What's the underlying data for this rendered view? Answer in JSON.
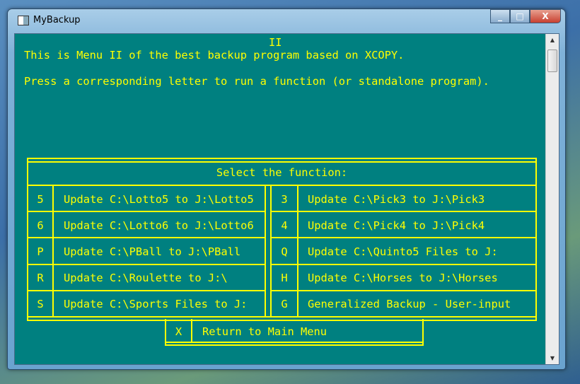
{
  "window": {
    "title": "MyBackup",
    "minimize": "_",
    "maximize": "□",
    "close": "X"
  },
  "console": {
    "heading": "II",
    "line1": "This is Menu II of the best backup program based on XCOPY.",
    "line2": "Press a corresponding letter to run a function (or standalone program)."
  },
  "menu": {
    "title": "Select the function:",
    "left": [
      {
        "key": "5",
        "label": "Update C:\\Lotto5 to J:\\Lotto5"
      },
      {
        "key": "6",
        "label": "Update C:\\Lotto6 to J:\\Lotto6"
      },
      {
        "key": "P",
        "label": "Update C:\\PBall to J:\\PBall"
      },
      {
        "key": "R",
        "label": "Update C:\\Roulette to J:\\"
      },
      {
        "key": "S",
        "label": "Update C:\\Sports Files to J:"
      }
    ],
    "right": [
      {
        "key": "3",
        "label": "Update C:\\Pick3 to J:\\Pick3"
      },
      {
        "key": "4",
        "label": "Update C:\\Pick4 to J:\\Pick4"
      },
      {
        "key": "Q",
        "label": "Update C:\\Quinto5 Files to J:"
      },
      {
        "key": "H",
        "label": "Update C:\\Horses to J:\\Horses"
      },
      {
        "key": "G",
        "label": "Generalized Backup - User-input"
      }
    ],
    "return": {
      "key": "X",
      "label": "Return to Main Menu"
    }
  },
  "colors": {
    "background": "#008080",
    "text": "#ffff00"
  }
}
